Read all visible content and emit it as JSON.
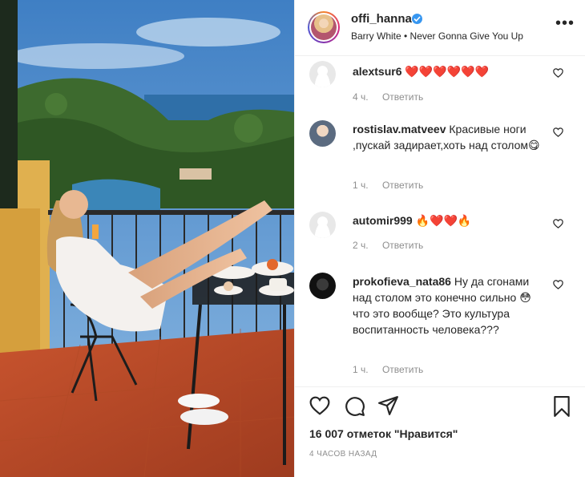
{
  "post": {
    "username": "offi_hanna",
    "music": "Barry White • Never Gonna Give You Up",
    "more_label": "•••"
  },
  "comments": [
    {
      "username": "alextsur6",
      "text": "❤️❤️❤️❤️❤️❤️",
      "time": "4 ч.",
      "reply": "Ответить"
    },
    {
      "username": "rostislav.matveev",
      "text": "Красивые ноги ,пускай задирает,хоть над столом😋",
      "time": "1 ч.",
      "reply": "Ответить"
    },
    {
      "username": "automir999",
      "text": "🔥❤️❤️🔥",
      "time": "2 ч.",
      "reply": "Ответить"
    },
    {
      "username": "prokofieva_nata86",
      "text": "Ну да сгонами над столом это конечно сильно 😳 что это вообще? Это культура воспитанность человека???",
      "time": "1 ч.",
      "reply": "Ответить"
    }
  ],
  "footer": {
    "likes": "16 007 отметок \"Нравится\"",
    "time_ago": "4 ЧАСОВ НАЗАД"
  },
  "colors": {
    "verified": "#3897f0",
    "muted": "#8e8e8e",
    "text": "#262626",
    "heart": "#ed4956"
  }
}
